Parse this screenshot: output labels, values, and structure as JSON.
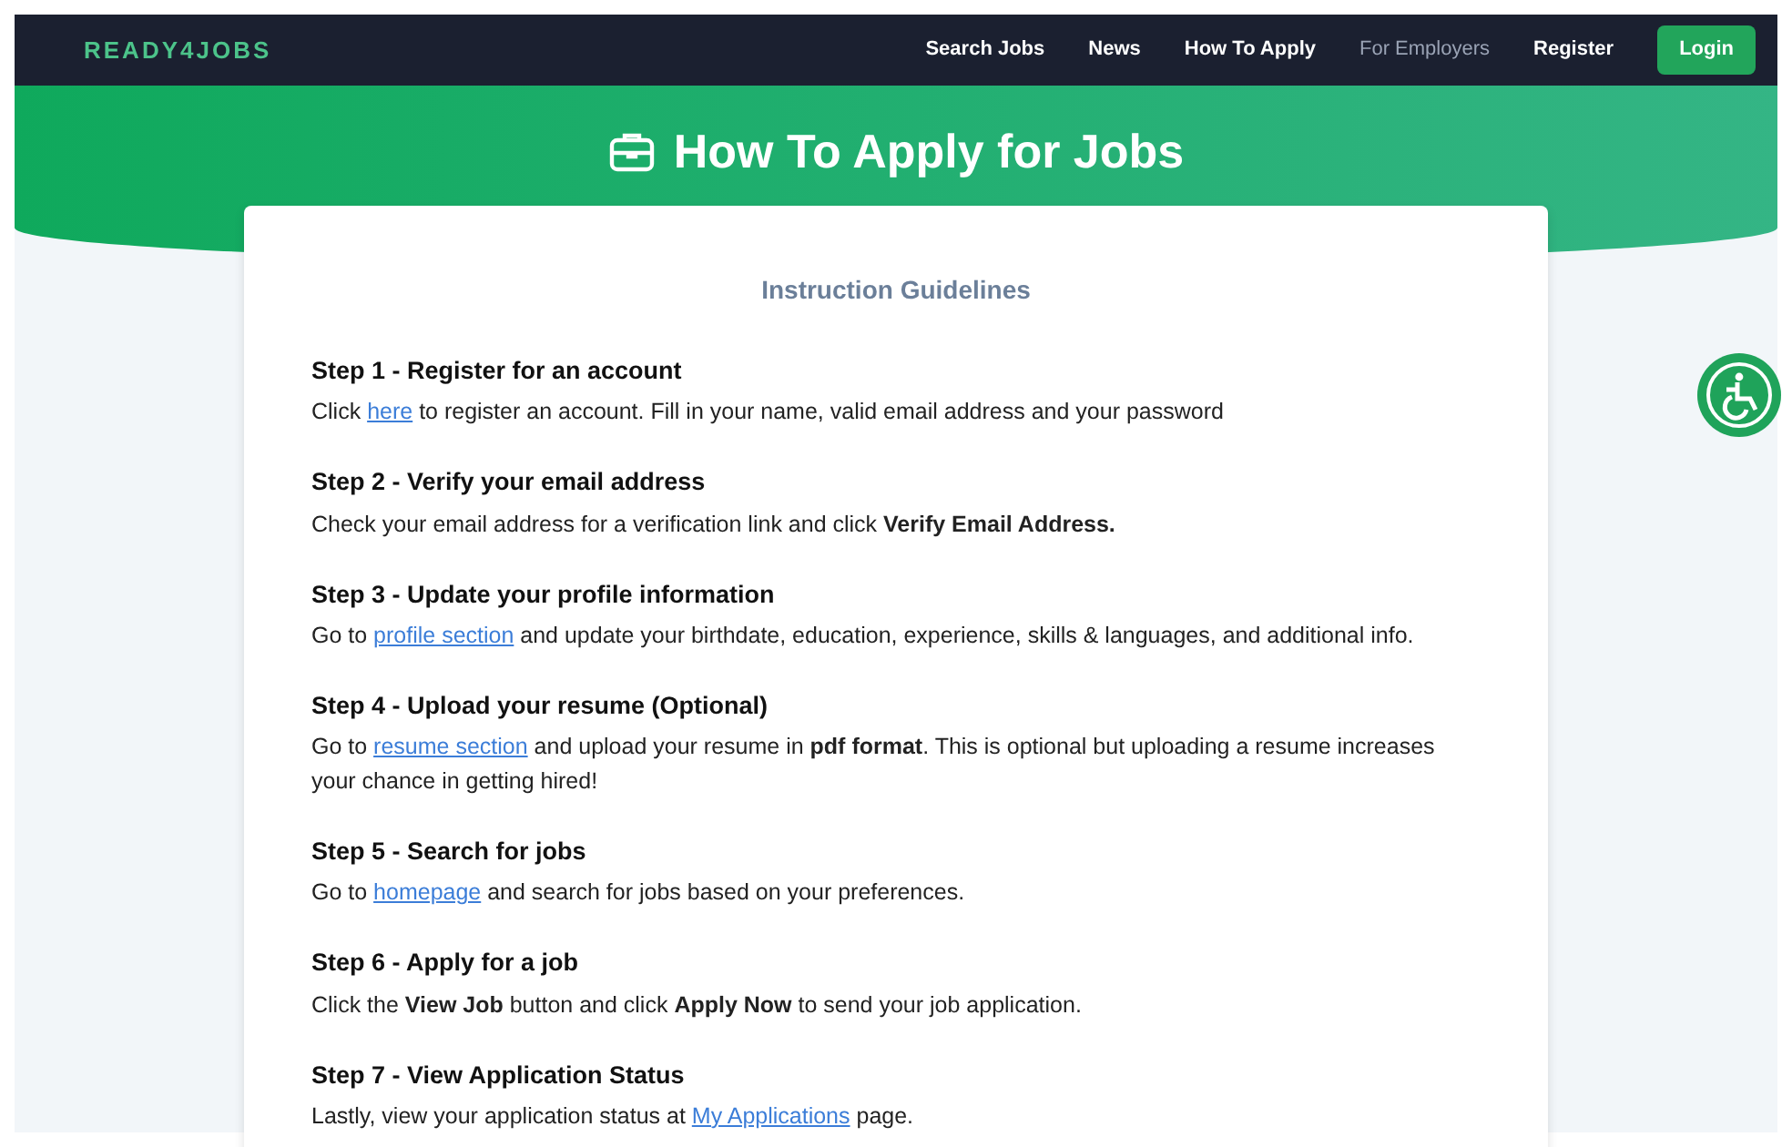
{
  "navbar": {
    "logo": "READY4JOBS",
    "items": [
      {
        "label": "Search Jobs",
        "kind": "link"
      },
      {
        "label": "News",
        "kind": "link"
      },
      {
        "label": "How To Apply",
        "kind": "link"
      },
      {
        "label": "For Employers",
        "kind": "dim"
      },
      {
        "label": "Register",
        "kind": "link"
      },
      {
        "label": "Login",
        "kind": "button"
      }
    ]
  },
  "header": {
    "title": "How To Apply for Jobs"
  },
  "card": {
    "heading": "Instruction Guidelines",
    "steps": [
      {
        "title": "Step 1 - Register for an account",
        "body": [
          {
            "kind": "text",
            "text": "Click "
          },
          {
            "kind": "link",
            "text": "here"
          },
          {
            "kind": "text",
            "text": " to register an account. Fill in your name, valid email address and your password"
          }
        ]
      },
      {
        "title": "Step 2 - Verify your email address",
        "body": [
          {
            "kind": "text",
            "text": "Check your email address for a verification link and click **Verify Email Address.**"
          }
        ]
      },
      {
        "title": "Step 3 - Update your profile information",
        "body": [
          {
            "kind": "text",
            "text": "Go to "
          },
          {
            "kind": "link",
            "text": "profile section"
          },
          {
            "kind": "text",
            "text": " and update your birthdate, education, experience, skills & languages, and additional info."
          }
        ]
      },
      {
        "title": "Step 4 - Upload your resume (Optional)",
        "body": [
          {
            "kind": "text",
            "text": "Go to "
          },
          {
            "kind": "link",
            "text": "resume section"
          },
          {
            "kind": "text",
            "text": " and upload your resume in **pdf format**. This is optional but uploading a resume increases your chance in getting hired!"
          }
        ]
      },
      {
        "title": "Step 5 - Search for jobs",
        "body": [
          {
            "kind": "text",
            "text": "Go to "
          },
          {
            "kind": "link",
            "text": "homepage"
          },
          {
            "kind": "text",
            "text": " and search for jobs based on your preferences."
          }
        ]
      },
      {
        "title": "Step 6 - Apply for a job",
        "body": [
          {
            "kind": "text",
            "text": "Click the **View Job** button and click **Apply Now** to send your job application."
          }
        ]
      },
      {
        "title": "Step 7 - View Application Status",
        "body": [
          {
            "kind": "text",
            "text": "Lastly, view your application status at "
          },
          {
            "kind": "link",
            "text": "My Applications"
          },
          {
            "kind": "text",
            "text": " page."
          }
        ]
      }
    ]
  }
}
